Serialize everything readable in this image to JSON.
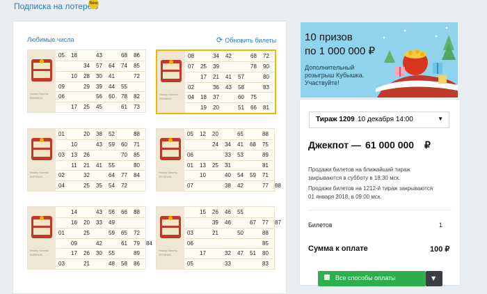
{
  "subscription": {
    "label": "Подписка на лотерею",
    "badge": "New"
  },
  "tickets_panel": {
    "favorite_label": "Любимые числа",
    "refresh_label": "Обновить билеты",
    "stub_label": "Номер билета:",
    "tickets": [
      {
        "id": "59988826",
        "rows": [
          [
            "05",
            "18",
            "",
            "43",
            "",
            "68",
            "86"
          ],
          [
            "",
            "",
            "34",
            "57",
            "64",
            "74",
            "85"
          ],
          [
            "",
            "10",
            "28",
            "30",
            "41",
            "",
            "72"
          ],
          [
            "09",
            "",
            "29",
            "39",
            "44",
            "55",
            ""
          ],
          [
            "06",
            "",
            "",
            "56",
            "60",
            "78",
            "82"
          ],
          [
            "",
            "17",
            "25",
            "45",
            "",
            "61",
            "73"
          ]
        ]
      },
      {
        "id": "59549960",
        "selected": true,
        "rows": [
          [
            "08",
            "",
            "34",
            "42",
            "",
            "68",
            "72"
          ],
          [
            "07",
            "25",
            "39",
            "",
            "",
            "78",
            "90"
          ],
          [
            "",
            "17",
            "21",
            "41",
            "57",
            "",
            "80"
          ],
          [
            "02",
            "",
            "36",
            "43",
            "58",
            "",
            "83"
          ],
          [
            "04",
            "18",
            "37",
            "",
            "60",
            "75",
            ""
          ],
          [
            "",
            "19",
            "20",
            "",
            "51",
            "66",
            "81"
          ]
        ]
      },
      {
        "id": "59675154",
        "rows": [
          [
            "01",
            "",
            "20",
            "38",
            "52",
            "",
            "88"
          ],
          [
            "",
            "10",
            "",
            "43",
            "59",
            "60",
            "71"
          ],
          [
            "03",
            "13",
            "26",
            "",
            "",
            "70",
            "85"
          ],
          [
            "",
            "11",
            "21",
            "41",
            "55",
            "",
            "80"
          ],
          [
            "02",
            "",
            "32",
            "",
            "64",
            "77",
            "84"
          ],
          [
            "04",
            "",
            "25",
            "35",
            "54",
            "72",
            ""
          ]
        ]
      },
      {
        "id": "59740148",
        "rows": [
          [
            "05",
            "12",
            "20",
            "",
            "65",
            "",
            "88"
          ],
          [
            "",
            "",
            "24",
            "34",
            "41",
            "68",
            "75"
          ],
          [
            "06",
            "",
            "",
            "33",
            "53",
            "",
            "89"
          ],
          [
            "01",
            "13",
            "25",
            "31",
            "",
            "",
            "81"
          ],
          [
            "",
            "10",
            "",
            "40",
            "54",
            "59",
            "71"
          ],
          [
            "07",
            "",
            "",
            "38",
            "42",
            "",
            "77",
            "88"
          ]
        ]
      },
      {
        "id": "59890436",
        "rows": [
          [
            "",
            "14",
            "",
            "43",
            "56",
            "66",
            "88"
          ],
          [
            "",
            "16",
            "20",
            "33",
            "49",
            "",
            ""
          ],
          [
            "01",
            "",
            "25",
            "",
            "59",
            "65",
            "72"
          ],
          [
            "",
            "09",
            "",
            "42",
            "",
            "61",
            "79",
            "84"
          ],
          [
            "",
            "17",
            "26",
            "30",
            "55",
            "",
            "89"
          ],
          [
            "03",
            "",
            "21",
            "",
            "48",
            "58",
            "86"
          ]
        ]
      },
      {
        "id": "59748180",
        "rows": [
          [
            "",
            "15",
            "26",
            "46",
            "55",
            "",
            ""
          ],
          [
            "",
            "",
            "39",
            "46",
            "",
            "67",
            "77",
            "87"
          ],
          [
            "03",
            "",
            "21",
            "",
            "50",
            "",
            "88"
          ],
          [
            "06",
            "",
            "",
            "",
            "",
            "",
            "85"
          ],
          [
            "",
            "17",
            "",
            "32",
            "47",
            "51",
            "80"
          ],
          [
            "05",
            "",
            "",
            "33",
            "",
            "",
            "83"
          ]
        ]
      }
    ]
  },
  "promo": {
    "headline_line1": "10 призов",
    "headline_line2": "по 1 000 000 ₽",
    "sub_line1": "Дополнительный",
    "sub_line2": "розыгрыш  Кубышка.",
    "sub_line3": "Участвуйте!"
  },
  "order": {
    "draw_label": "Тираж 1209",
    "draw_date": "10 декабря 14:00",
    "jackpot_label": "Джекпот —",
    "jackpot_value": "61 000 000",
    "currency": "₽",
    "info1_line1": "Продажи билетов на ближайший тираж",
    "info1_line2": "закрываются в субботу в 18:30 мск.",
    "info2_line1": "Продажи билетов на 1212-й тираж закрываются",
    "info2_line2": "01 января 2018, в 09:00 мск.",
    "tickets_label": "Билетов",
    "tickets_count": "1",
    "total_label": "Сумма к оплате",
    "total_value": "100 ₽",
    "pay_button": "Все способы оплаты"
  }
}
